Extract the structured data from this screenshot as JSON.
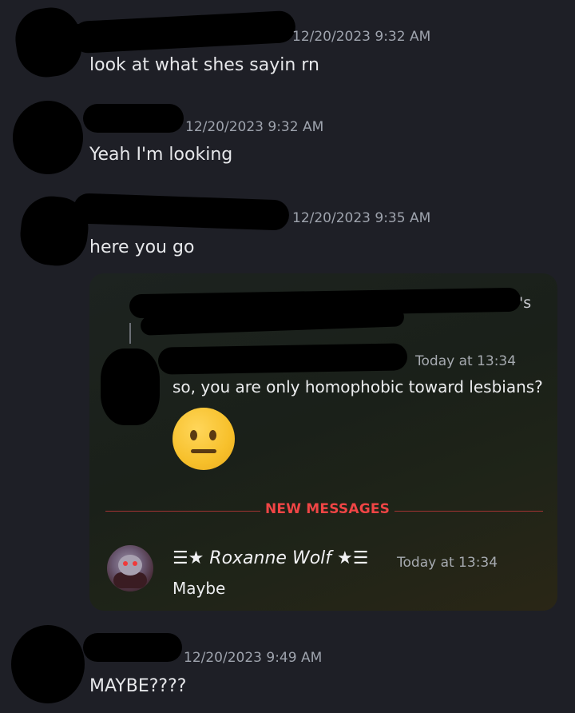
{
  "messages": [
    {
      "timestamp": "12/20/2023 9:32 AM",
      "text": "look at what shes sayin rn"
    },
    {
      "timestamp": "12/20/2023 9:32 AM",
      "text": "Yeah I'm looking"
    },
    {
      "timestamp": "12/20/2023 9:35 AM",
      "text": "here you go"
    },
    {
      "timestamp": "12/20/2023 9:49 AM",
      "text": "MAYBE????"
    }
  ],
  "embed": {
    "partial_text": "'s",
    "message1": {
      "timestamp": "Today at 13:34",
      "text": "so, you are only homophobic toward lesbians?",
      "emoji": "neutral-face"
    },
    "divider_label": "NEW MESSAGES",
    "message2": {
      "username": "☰★ Roxanne Wolf ★☰",
      "timestamp": "Today at 13:34",
      "text": "Maybe"
    }
  },
  "colors": {
    "background": "#1e1f26",
    "new_messages_red": "#f04545",
    "timestamp_gray": "#9ea3ad"
  }
}
